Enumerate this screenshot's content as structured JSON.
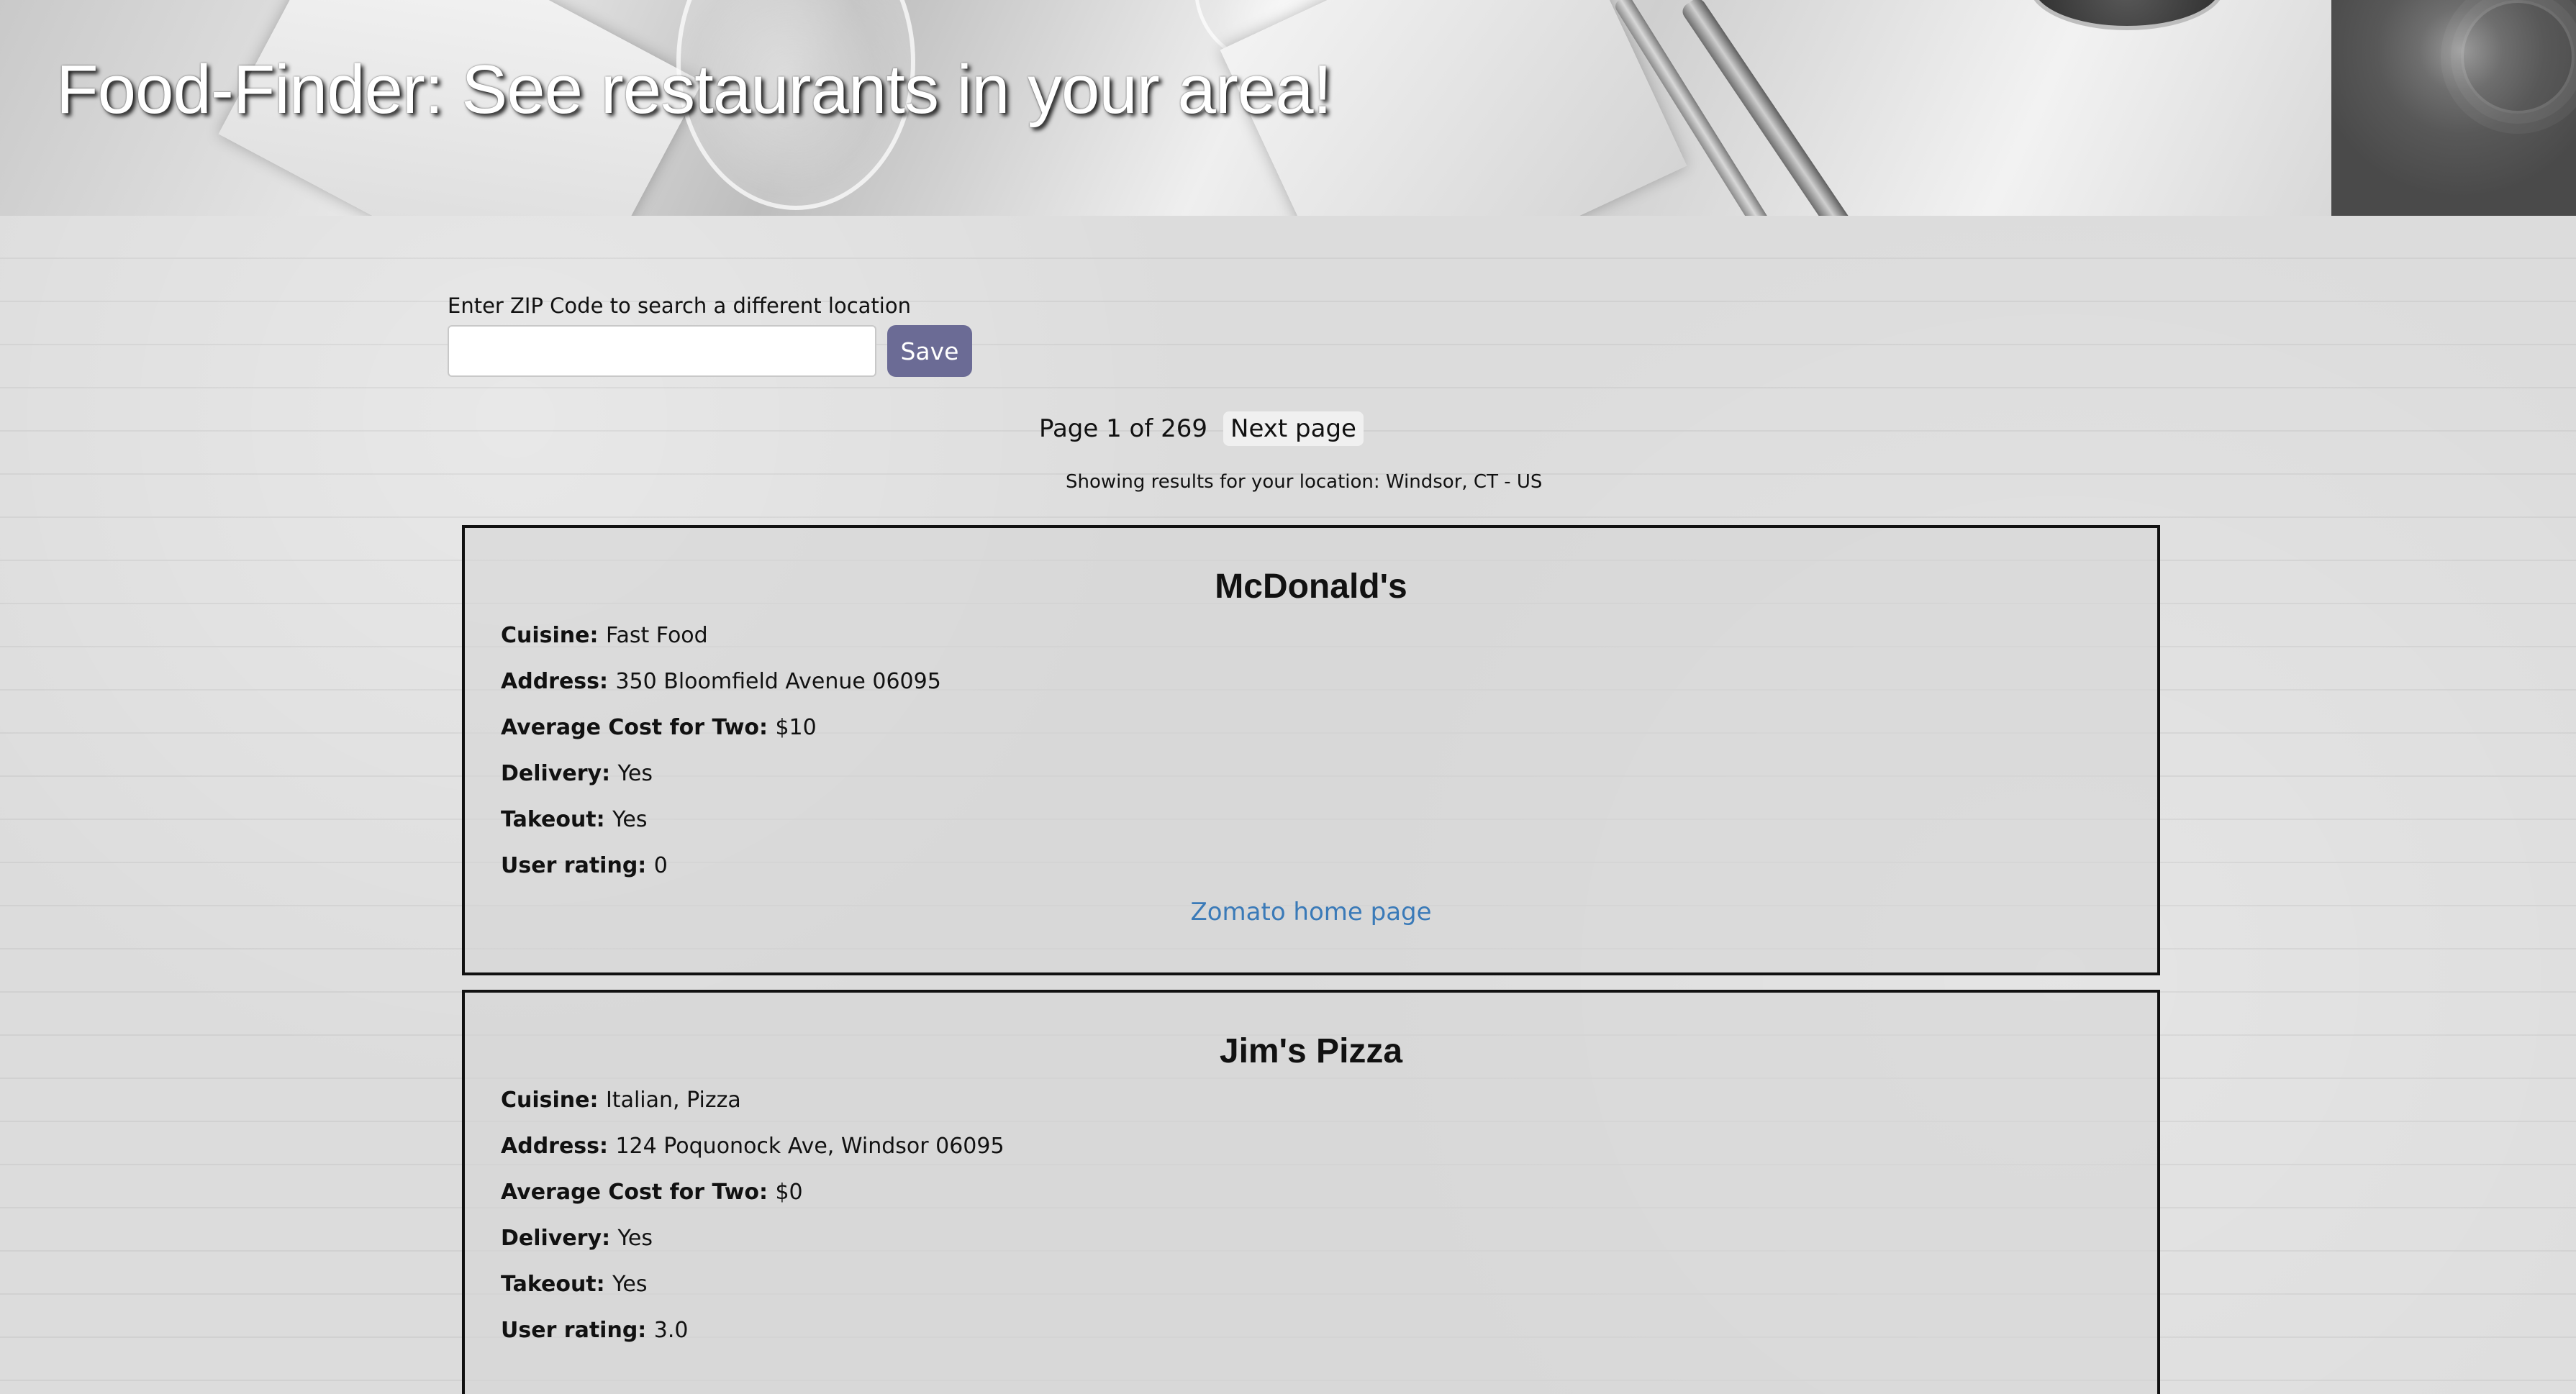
{
  "header": {
    "title": "Food-Finder: See restaurants in your area!"
  },
  "search": {
    "label": "Enter ZIP Code to search a different location",
    "value": "",
    "placeholder": "",
    "button_label": "Save"
  },
  "pagination": {
    "indicator": "Page 1 of 269",
    "next_label": "Next page"
  },
  "location": {
    "text": "Showing results for your location: Windsor, CT - US"
  },
  "labels": {
    "cuisine": "Cuisine:",
    "address": "Address:",
    "avg_cost": "Average Cost for Two:",
    "delivery": "Delivery:",
    "takeout": "Takeout:",
    "rating": "User rating:"
  },
  "restaurants": [
    {
      "name": "McDonald's",
      "cuisine": "Fast Food",
      "address": "350 Bloomfield Avenue 06095",
      "avg_cost": "$10",
      "delivery": "Yes",
      "takeout": "Yes",
      "rating": "0",
      "link_label": "Zomato home page"
    },
    {
      "name": "Jim's Pizza",
      "cuisine": "Italian, Pizza",
      "address": "124 Poquonock Ave, Windsor 06095",
      "avg_cost": "$0",
      "delivery": "Yes",
      "takeout": "Yes",
      "rating": "3.0"
    }
  ],
  "colors": {
    "save_button": "#6b6b95",
    "link": "#3a7ab8",
    "card_border": "#111111"
  }
}
